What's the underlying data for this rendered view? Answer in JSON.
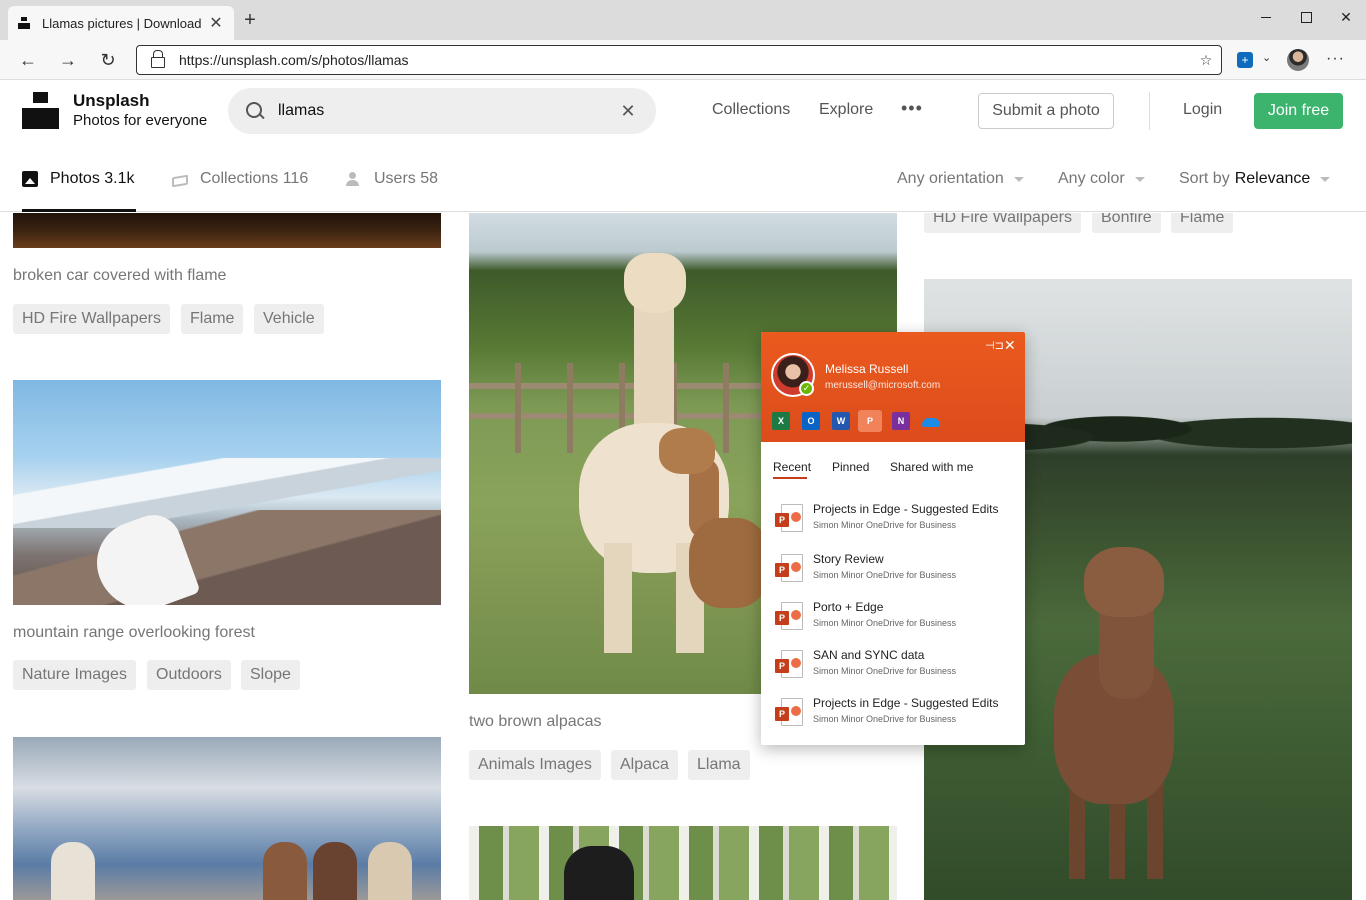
{
  "browser": {
    "tab_title": "Llamas pictures | Download",
    "tab_close": "✕",
    "new_tab": "+",
    "url": "https://unsplash.com/s/photos/llamas",
    "back": "←",
    "forward": "→",
    "reload": "↻",
    "favorites_icon": "☆",
    "win_close": "✕",
    "menu": "···",
    "chevron": "⌄"
  },
  "header": {
    "brand_name": "Unsplash",
    "brand_tagline": "Photos for everyone",
    "search_value": "llamas",
    "clear": "✕",
    "nav_collections": "Collections",
    "nav_explore": "Explore",
    "more": "•••",
    "submit": "Submit a photo",
    "login": "Login",
    "join": "Join free"
  },
  "filters": {
    "tabs": [
      {
        "label": "Photos 3.1k"
      },
      {
        "label": "Collections 116"
      },
      {
        "label": "Users 58"
      }
    ],
    "orientation": "Any orientation",
    "color": "Any color",
    "sort_prefix": "Sort by",
    "sort_value": "Relevance"
  },
  "gallery": {
    "col1": {
      "car_caption": "broken car covered with flame",
      "car_tags": [
        "HD Fire Wallpapers",
        "Flame",
        "Vehicle"
      ],
      "mountain_caption": "mountain range overlooking forest",
      "mountain_tags": [
        "Nature Images",
        "Outdoors",
        "Slope"
      ]
    },
    "col2": {
      "alpaca_caption": "two brown alpacas",
      "alpaca_tags": [
        "Animals Images",
        "Alpaca",
        "Llama"
      ]
    },
    "col3": {
      "top_tags": [
        "HD Fire Wallpapers",
        "Bonfire",
        "Flame"
      ]
    }
  },
  "flyout": {
    "user_name": "Melissa Russell",
    "user_email": "merussell@microsoft.com",
    "pin": "⊣⊐",
    "close": "✕",
    "apps": {
      "excel": "X",
      "outlook": "O",
      "word": "W",
      "powerpoint": "P",
      "onenote": "N"
    },
    "tabs": {
      "recent": "Recent",
      "pinned": "Pinned",
      "shared": "Shared with me"
    },
    "documents": [
      {
        "title": "Projects in Edge - Suggested Edits",
        "location": "Simon Minor OneDrive for Business"
      },
      {
        "title": "Story Review",
        "location": "Simon Minor OneDrive for Business"
      },
      {
        "title": "Porto + Edge",
        "location": "Simon Minor OneDrive for Business"
      },
      {
        "title": "SAN and SYNC data",
        "location": "Simon Minor OneDrive for Business"
      },
      {
        "title": "Projects in Edge - Suggested Edits",
        "location": "Simon Minor OneDrive for Business"
      }
    ],
    "doc_badge": "P"
  },
  "colors": {
    "join_green": "#3cb46e",
    "flyout_orange": "#ea5a1e",
    "powerpoint_red": "#c43e1c"
  }
}
